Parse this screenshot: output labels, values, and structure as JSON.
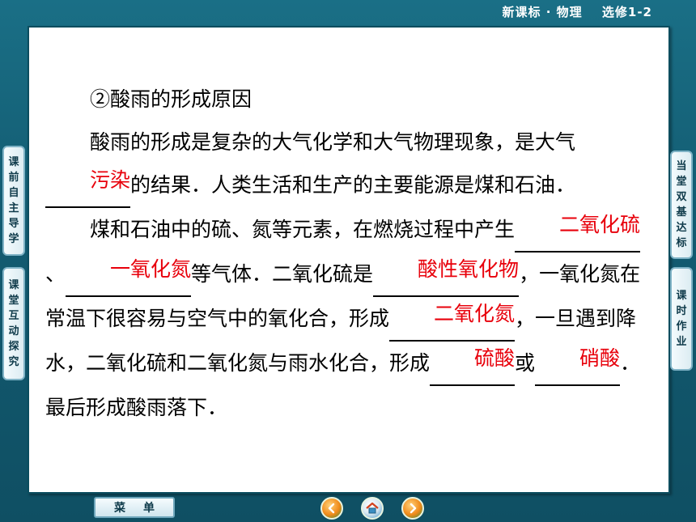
{
  "header": {
    "series": "新课标 · 物理",
    "volume": "选修1-2"
  },
  "left_tabs": [
    {
      "label": "课前自主导学"
    },
    {
      "label": "课堂互动探究"
    }
  ],
  "right_tabs": [
    {
      "label": "当堂双基达标"
    },
    {
      "label": "课时作业"
    }
  ],
  "content": {
    "heading": "②酸雨的形成原因",
    "p1_a": "酸雨的形成是复杂的大气化学和大气物理现象，是大气",
    "p1_blank1": "污染",
    "p1_b": "的结果．人类生活和生产的主要能源是煤和石油．",
    "p2_a": "煤和石油中的硫、氮等元素，在燃烧过程中产生",
    "p2_blank1": "二氧化硫",
    "p2_b": "、",
    "p2_blank2": "一氧化氮",
    "p2_c": "等气体．二氧化硫是",
    "p2_blank3": "酸性氧化物",
    "p2_d": "，一氧化氮在常温下很容易与空气中的氧化合，形成",
    "p2_blank4": "二氧化氮",
    "p2_e": "，一旦遇到降水，二氧化硫和二氧化氮与雨水化合，形成",
    "p2_blank5": "硫酸",
    "p2_f": "或",
    "p2_blank6": "硝酸",
    "p2_g": "．最后形成酸雨落下．"
  },
  "bottom": {
    "menu_label": "菜单"
  },
  "colors": {
    "answer": "#e8000b",
    "background": "#135c72"
  },
  "icons": [
    "prev-icon",
    "home-icon",
    "next-icon"
  ]
}
